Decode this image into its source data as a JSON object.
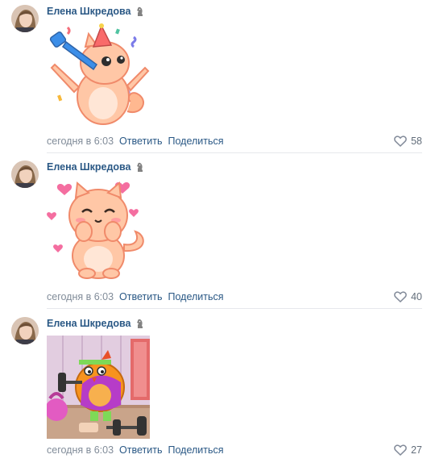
{
  "comments": [
    {
      "author": "Елена Шкредова",
      "sticker": "party-cat-sticker",
      "time": "сегодня в 6:03",
      "reply_label": "Ответить",
      "share_label": "Поделиться",
      "likes": "58"
    },
    {
      "author": "Елена Шкредова",
      "sticker": "shy-cat-hearts-sticker",
      "time": "сегодня в 6:03",
      "reply_label": "Ответить",
      "share_label": "Поделиться",
      "likes": "40"
    },
    {
      "author": "Елена Шкредова",
      "sticker": "bird-dumbbells-sticker",
      "time": "сегодня в 6:03",
      "reply_label": "Ответить",
      "share_label": "Поделиться",
      "likes": "27"
    }
  ],
  "icons": {
    "badge": "knight-badge-icon",
    "like": "heart-icon"
  },
  "colors": {
    "link": "#2a5885",
    "meta": "#818c99",
    "divider": "#e7e8ec"
  }
}
